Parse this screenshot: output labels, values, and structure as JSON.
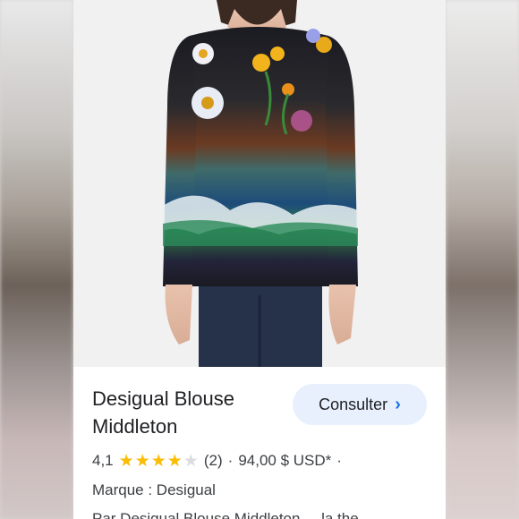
{
  "product": {
    "title_line1": "Desigual Blouse",
    "title_line2": "Middleton",
    "action_label": "Consulter",
    "rating_value": "4,1",
    "rating_stars": 4.1,
    "review_count": "(2)",
    "separator": "·",
    "price": "94,00 $ USD*",
    "trailing_separator": "·",
    "brand": "Marque : Desigual",
    "snippet": "Par Desigual Blouse Middleton ... la the"
  },
  "colors": {
    "star": "#fbbc04",
    "star_empty": "#dadce0",
    "button_bg": "#e8f0fe",
    "chevron": "#1a73e8"
  },
  "icons": {
    "chevron": "chevron-right-icon",
    "star": "star-icon"
  }
}
